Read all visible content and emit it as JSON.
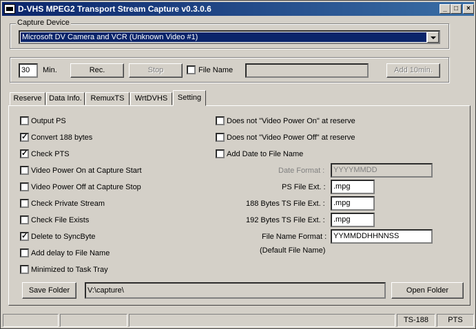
{
  "window": {
    "title": "D-VHS MPEG2 Transport Stream Capture v0.3.0.6",
    "minimize": "_",
    "maximize": "□",
    "close": "×"
  },
  "capture_device": {
    "group_label": "Capture Device",
    "selected": "Microsoft DV Camera and VCR (Unknown Video #1)"
  },
  "controls": {
    "minutes_value": "30",
    "minutes_label": "Min.",
    "rec_label": "Rec.",
    "stop_label": "Stop",
    "file_name_label": "File Name",
    "file_name_value": "",
    "add10_label": "Add 10min."
  },
  "tabs": [
    {
      "label": "Reserve"
    },
    {
      "label": "Data Info."
    },
    {
      "label": "RemuxTS"
    },
    {
      "label": "WrtDVHS"
    },
    {
      "label": "Setting"
    }
  ],
  "settings_left": [
    {
      "label": "Output PS",
      "checked": false
    },
    {
      "label": "Convert 188 bytes",
      "checked": true
    },
    {
      "label": "Check PTS",
      "checked": true
    },
    {
      "label": "Video Power On at Capture Start",
      "checked": false
    },
    {
      "label": "Video Power Off at Capture Stop",
      "checked": false
    },
    {
      "label": "Check Private Stream",
      "checked": false
    },
    {
      "label": "Check File Exists",
      "checked": false
    },
    {
      "label": "Delete to SyncByte",
      "checked": true
    },
    {
      "label": "Add delay to File Name",
      "checked": false
    },
    {
      "label": "Minimized to Task Tray",
      "checked": false
    }
  ],
  "settings_right": [
    {
      "label": "Does not \"Video Power On\" at reserve",
      "checked": false
    },
    {
      "label": "Does not \"Video Power Off\" at reserve",
      "checked": false
    },
    {
      "label": "Add Date to File Name",
      "checked": false
    }
  ],
  "fields": {
    "date_format_label": "Date Format :",
    "date_format_value": "YYYYMMDD",
    "ps_ext_label": "PS File Ext. :",
    "ps_ext_value": ".mpg",
    "ts188_ext_label": "188 Bytes TS File Ext. :",
    "ts188_ext_value": ".mpg",
    "ts192_ext_label": "192 Bytes TS File Ext. :",
    "ts192_ext_value": ".mpg",
    "name_format_label": "File Name Format :",
    "name_format_value": "YYMMDDHHNNSS",
    "default_file_name_note": "(Default File Name)"
  },
  "folder": {
    "save_folder_label": "Save Folder",
    "path": "V:\\capture\\",
    "open_folder_label": "Open Folder"
  },
  "statusbar": {
    "cells": [
      "",
      "",
      "",
      "TS-188",
      "PTS"
    ]
  }
}
